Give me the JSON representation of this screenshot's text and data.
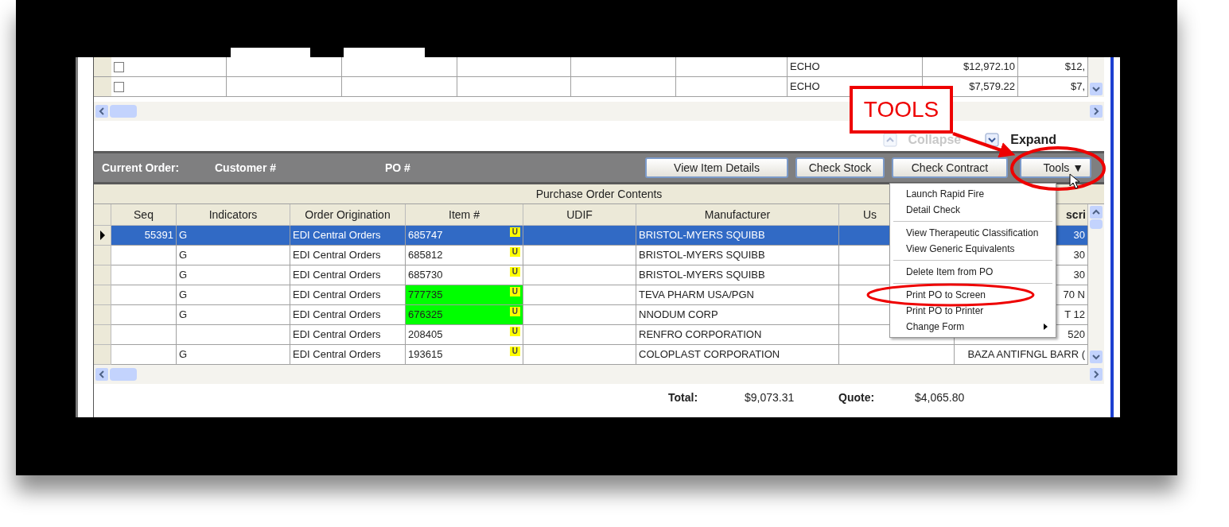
{
  "top_table": {
    "rows": [
      {
        "checked": false,
        "source": "ECHO",
        "amount": "$12,972.10",
        "column_9": "$12,"
      },
      {
        "checked": false,
        "source": "ECHO",
        "amount": "$7,579.22",
        "column_9": "$7,"
      }
    ]
  },
  "panel_toggles": [
    {
      "label": "Collapse",
      "disabled": true
    },
    {
      "label": "Expand",
      "disabled": false
    }
  ],
  "order_bar": {
    "labels": [
      "Current Order:",
      "Customer #",
      "PO #"
    ],
    "buttons": [
      {
        "label": "View Item Details"
      },
      {
        "label": "Check Stock"
      },
      {
        "label": "Check Contract"
      },
      {
        "label": "Tools ▼",
        "kind": "dropdown"
      }
    ]
  },
  "contents": {
    "title": "Purchase Order Contents",
    "columns": [
      "Seq",
      "Indicators",
      "Order Origination",
      "Item #",
      "UDIF",
      "Manufacturer",
      "Us",
      "scri"
    ],
    "rows": [
      {
        "selected": true,
        "seq": "55391",
        "indicator": "G",
        "origination": "EDI Central Orders",
        "item": "685747",
        "flagged": false,
        "badge": "U",
        "manufacturer": "BRISTOL-MYERS SQUIBB",
        "column_8": "30"
      },
      {
        "selected": false,
        "indicator": "G",
        "origination": "EDI Central Orders",
        "item": "685812",
        "flagged": false,
        "badge": "U",
        "manufacturer": "BRISTOL-MYERS SQUIBB",
        "column_8": "30"
      },
      {
        "selected": false,
        "indicator": "G",
        "origination": "EDI Central Orders",
        "item": "685730",
        "flagged": false,
        "badge": "U",
        "manufacturer": "BRISTOL-MYERS SQUIBB",
        "column_8": "30"
      },
      {
        "selected": false,
        "indicator": "G",
        "origination": "EDI Central Orders",
        "item": "777735",
        "flagged": true,
        "badge": "U",
        "manufacturer": "TEVA PHARM USA/PGN",
        "column_8": "70 N"
      },
      {
        "selected": false,
        "indicator": "G",
        "origination": "EDI Central Orders",
        "item": "676325",
        "flagged": true,
        "badge": "U",
        "manufacturer": "NNODUM CORP",
        "column_8": "T 12"
      },
      {
        "selected": false,
        "origination": "EDI Central Orders",
        "item": "208405",
        "flagged": false,
        "badge": "U",
        "manufacturer": "RENFRO CORPORATION",
        "column_8": "520"
      },
      {
        "selected": false,
        "indicator": "G",
        "origination": "EDI Central Orders",
        "item": "193615",
        "flagged": false,
        "badge": "U",
        "manufacturer": "COLOPLAST CORPORATION",
        "column_8": "BAZA ANTIFNGL BARR ("
      }
    ]
  },
  "totals": [
    {
      "label": "Total:",
      "value": "$9,073.31"
    },
    {
      "label": "Quote:",
      "value": "$4,065.80"
    }
  ],
  "tools_menu": [
    {
      "kind": "item",
      "label": "Launch Rapid Fire",
      "circled": false
    },
    {
      "kind": "item",
      "label": "Detail Check",
      "circled": false
    },
    {
      "kind": "separator"
    },
    {
      "kind": "item",
      "label": "View Therapeutic Classification",
      "circled": false
    },
    {
      "kind": "item",
      "label": "View Generic Equivalents",
      "circled": false
    },
    {
      "kind": "separator"
    },
    {
      "kind": "item",
      "label": "Delete Item from PO",
      "circled": false
    },
    {
      "kind": "separator"
    },
    {
      "kind": "item",
      "label": "Print PO to Screen",
      "circled": true
    },
    {
      "kind": "item",
      "label": "Print PO to Printer",
      "circled": false
    },
    {
      "kind": "submenu",
      "label": "Change Form",
      "circled": false
    }
  ],
  "annotation": {
    "label": "TOOLS"
  }
}
